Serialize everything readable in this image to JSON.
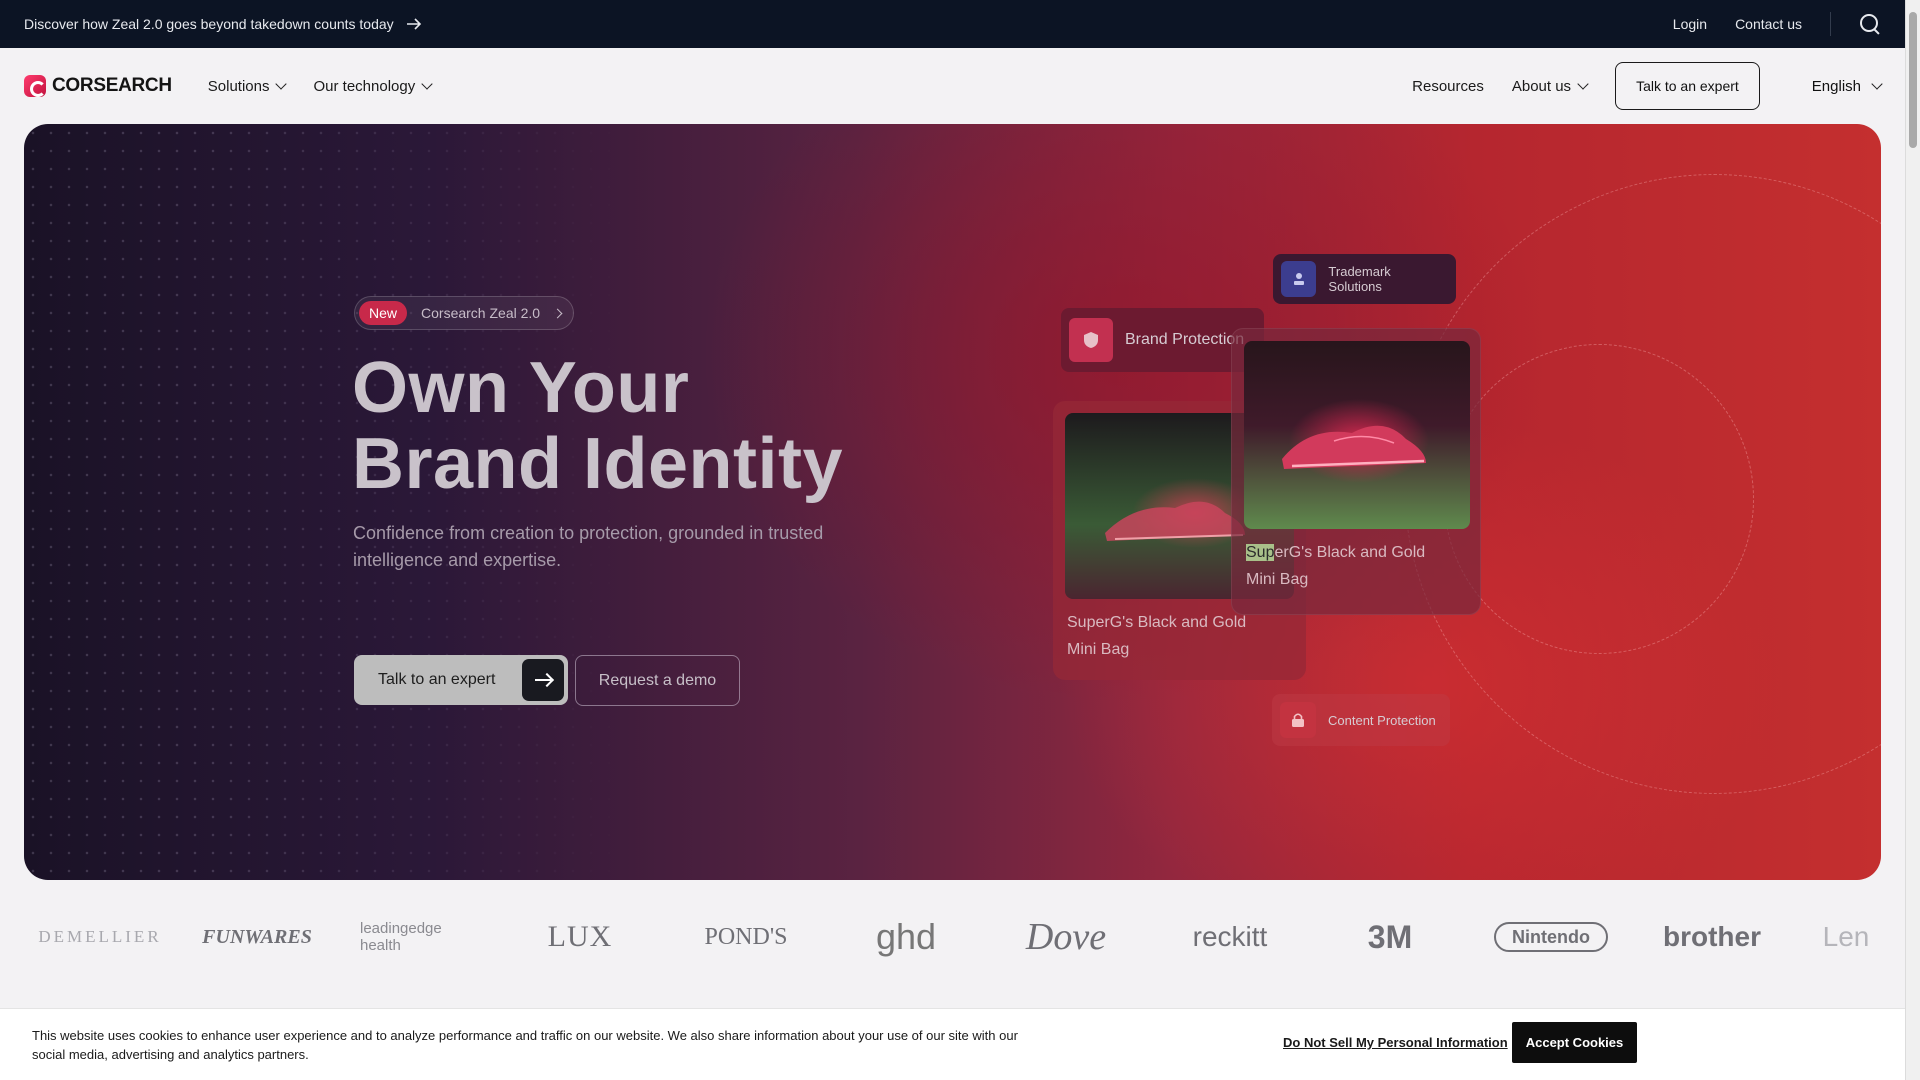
{
  "announcement": {
    "text": "Discover how Zeal 2.0 goes beyond takedown counts today",
    "login": "Login",
    "contact": "Contact us"
  },
  "nav": {
    "brand": "CORSEARCH",
    "left": [
      {
        "label": "Solutions"
      },
      {
        "label": "Our technology"
      }
    ],
    "resources": "Resources",
    "about": "About us",
    "cta": "Talk to an expert",
    "language": "English"
  },
  "hero": {
    "badge_new": "New",
    "badge_text": "Corsearch Zeal 2.0",
    "headline_line1": "Own Your",
    "headline_line2": "Brand Identity",
    "subtitle": "Confidence from creation to protection, grounded in trusted intelligence and expertise.",
    "cta_primary": "Talk to an expert",
    "cta_secondary": "Request a demo",
    "tags": {
      "trademark": "Trademark Solutions",
      "brand": "Brand Protection",
      "content": "Content Protection"
    },
    "product_back": {
      "line1": "SuperG's Black and Gold",
      "line2": "Mini Bag"
    },
    "product_front": {
      "highlight": "Sup",
      "rest1": "erG's Black and Gold",
      "line2": "Mini Bag"
    }
  },
  "logos": [
    "DEMELLIER",
    "FUNWARES",
    "leadingedge health",
    "LUX",
    "POND'S",
    "ghd",
    "Dove",
    "reckitt",
    "3M",
    "Nintendo",
    "brother",
    "Len"
  ],
  "cookie": {
    "message": "This website uses cookies to enhance user experience and to analyze performance and traffic on our website. We also share information about your use of our site with our social media, advertising and analytics partners.",
    "do_not_sell": "Do Not Sell My Personal Information",
    "accept": "Accept Cookies"
  },
  "colors": {
    "announce_bg": "#0c1424",
    "brand": "#c8294a",
    "accept_bg": "#0d0d0d"
  },
  "icons": [
    "arrow-right-icon",
    "search-icon",
    "chevron-down-icon",
    "shield-icon",
    "person-icon",
    "lock-icon"
  ]
}
